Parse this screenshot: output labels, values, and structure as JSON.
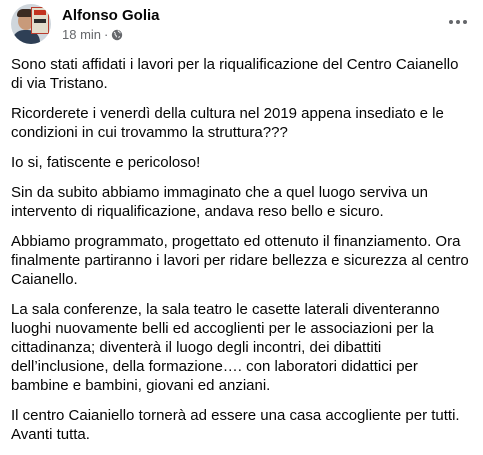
{
  "post": {
    "author": "Alfonso Golia",
    "time": "18 min",
    "separator": "·",
    "avatar_icon": "profile-photo",
    "privacy_icon": "globe-icon",
    "more_icon": "more-options-icon",
    "paragraphs": [
      "Sono stati affidati i lavori per la riqualificazione del Centro Caianello di via Tristano.",
      "Ricorderete i venerdì della cultura nel 2019 appena insediato e le condizioni in cui trovammo la struttura???",
      "Io si, fatiscente e pericoloso!",
      "Sin da subito abbiamo immaginato che a quel luogo serviva un intervento di riqualificazione, andava reso bello e sicuro.",
      "Abbiamo programmato,  progettato ed ottenuto il finanziamento. Ora finalmente partiranno i lavori per ridare bellezza e sicurezza al centro Caianello.",
      "La sala conferenze, la sala teatro le casette laterali diventeranno luoghi nuovamente belli ed accoglienti  per le associazioni per la cittadinanza; diventerà il luogo degli incontri, dei dibattiti dell’inclusione,  della formazione…. con laboratori didattici per bambine e bambini, giovani ed anziani.",
      "Il centro Caianiello tornerà ad essere una casa accogliente per tutti. Avanti tutta."
    ]
  },
  "colors": {
    "text": "#050505",
    "secondary_text": "#65676b",
    "background": "#ffffff"
  }
}
